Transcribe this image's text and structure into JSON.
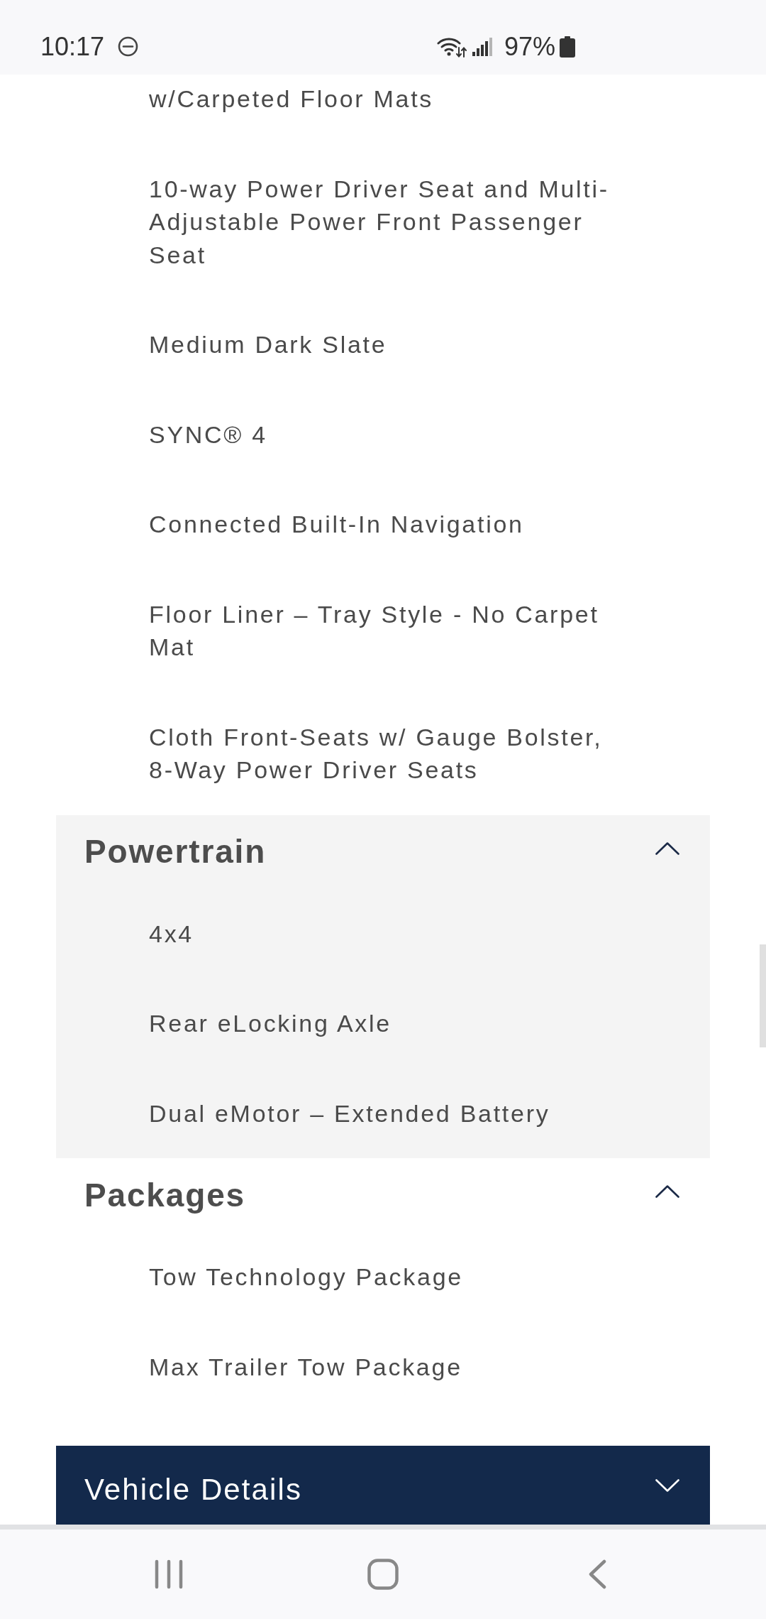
{
  "status_bar": {
    "time": "10:17",
    "battery": "97%"
  },
  "continued_items": [
    "w/Carpeted Floor Mats",
    "10-way Power Driver Seat and Multi-Adjustable Power Front Passenger Seat",
    "Medium Dark Slate",
    "SYNC® 4",
    "Connected Built-In Navigation",
    "Floor Liner – Tray Style - No Carpet Mat",
    "Cloth Front-Seats w/ Gauge Bolster, 8-Way Power Driver Seats"
  ],
  "sections": [
    {
      "kind": "sub",
      "title": "Powertrain",
      "expanded": true,
      "color": "#f4f4f4",
      "items": [
        "4x4",
        "Rear eLocking Axle",
        "Dual eMotor – Extended Battery"
      ]
    },
    {
      "kind": "sub",
      "title": "Packages",
      "expanded": true,
      "color": "#ffffff",
      "items": [
        "Tow Technology Package",
        "Max Trailer Tow Package"
      ]
    },
    {
      "kind": "main",
      "title": "Vehicle Details",
      "expanded": false,
      "color": "#13294b"
    }
  ]
}
